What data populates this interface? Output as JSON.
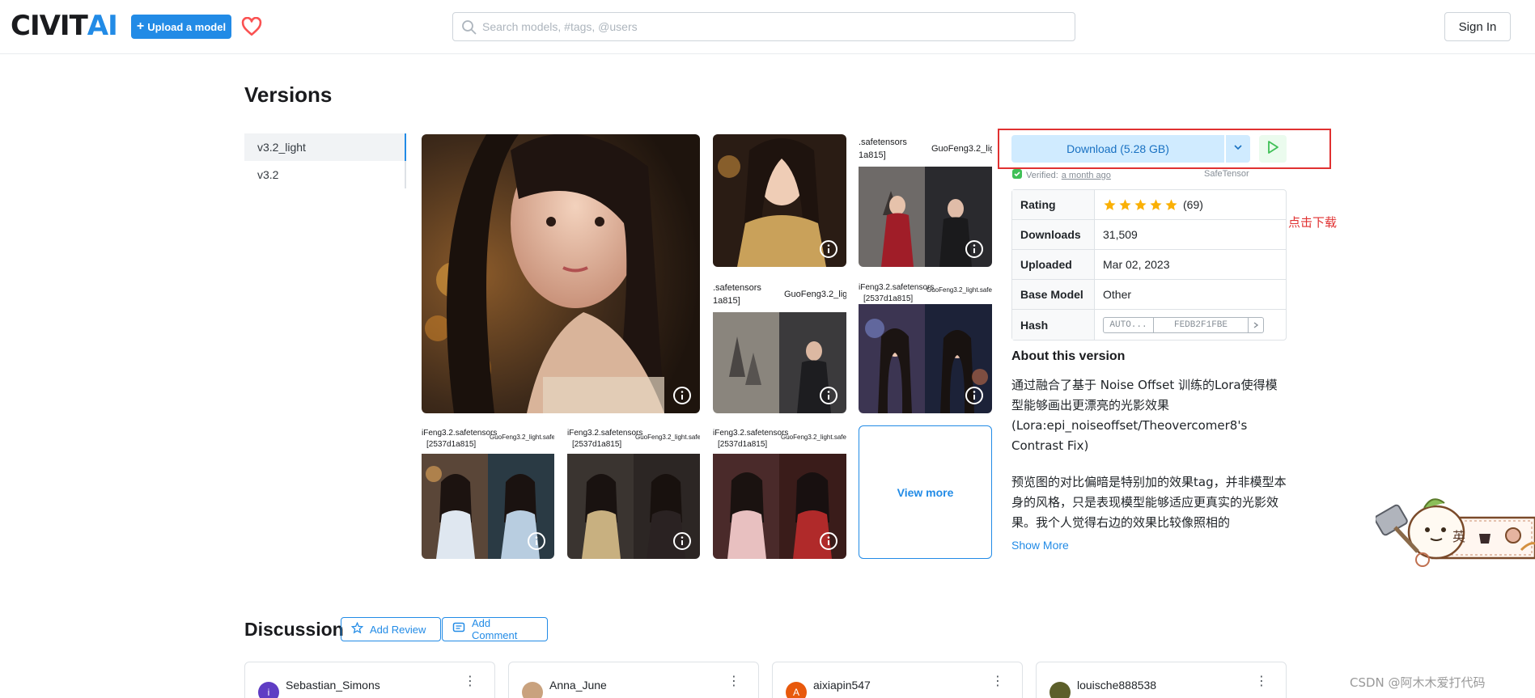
{
  "header": {
    "logo_part1": "CIVIT",
    "logo_part2": "AI",
    "upload_label": "Upload a model",
    "search_placeholder": "Search models, #tags, @users",
    "signin_label": "Sign In"
  },
  "versions": {
    "title": "Versions",
    "tabs": [
      {
        "label": "v3.2_light",
        "active": true
      },
      {
        "label": "v3.2",
        "active": false
      }
    ]
  },
  "gallery": {
    "overlay_texts": {
      "t1": ".safetensors",
      "t2": "1a815]",
      "t3": "GuoFeng3.2_lig",
      "t4": ".safetensors",
      "t5": "1a815]",
      "t6": "GuoFeng3.2_lig",
      "t7": "iFeng3.2.safetensors",
      "t8": "[2537d1a815]",
      "t9": "GuoFeng3.2_light.safeten",
      "b1a": "iFeng3.2.safetensors",
      "b1b": "[2537d1a815]",
      "b1c": "GuoFeng3.2_light.safeten",
      "b2a": "iFeng3.2.safetensors",
      "b2b": "[2537d1a815]",
      "b2c": "GuoFeng3.2_light.safeten",
      "b3a": "iFeng3.2.safetensors",
      "b3b": "[2537d1a815]",
      "b3c": "GuoFeng3.2_light.safeten"
    },
    "view_more_label": "View more"
  },
  "download": {
    "label": "Download (5.28 GB)",
    "verified_prefix": "Verified:",
    "verified_time": "a month ago",
    "file_format": "SafeTensor",
    "annotation": "点击下载"
  },
  "details": {
    "rating_label": "Rating",
    "rating_stars": 5,
    "rating_count": "(69)",
    "downloads_label": "Downloads",
    "downloads_value": "31,509",
    "uploaded_label": "Uploaded",
    "uploaded_value": "Mar 02, 2023",
    "base_model_label": "Base Model",
    "base_model_value": "Other",
    "hash_label": "Hash",
    "hash_type": "AUTO...",
    "hash_value": "FEDB2F1FBE"
  },
  "about": {
    "title": "About this version",
    "paragraph1": "通过融合了基于 Noise Offset 训练的Lora使得模型能够画出更漂亮的光影效果(Lora:epi_noiseoffset/Theovercomer8's Contrast Fix)",
    "paragraph2": "预览图的对比偏暗是特别加的效果tag，并非模型本身的风格，只是表现模型能够适应更真实的光影效果。我个人觉得右边的效果比较像照相的",
    "show_more": "Show More"
  },
  "discussion": {
    "title": "Discussion",
    "add_review": "Add Review",
    "add_comment": "Add Comment",
    "users": [
      {
        "name": "Sebastian_Simons",
        "initial": "i",
        "color": "#5f3dc4"
      },
      {
        "name": "Anna_June",
        "initial": "",
        "color": "#c9a27e"
      },
      {
        "name": "aixiapin547",
        "initial": "A",
        "color": "#e8590c"
      },
      {
        "name": "louische888538",
        "initial": "",
        "color": "#5c5f2a"
      }
    ]
  },
  "mascot": {
    "char": "英"
  },
  "watermark": "CSDN @阿木木爱打代码",
  "colors": {
    "accent": "#228be6",
    "annotation_red": "#e03131",
    "star": "#fab005",
    "verified_green": "#40c057"
  }
}
